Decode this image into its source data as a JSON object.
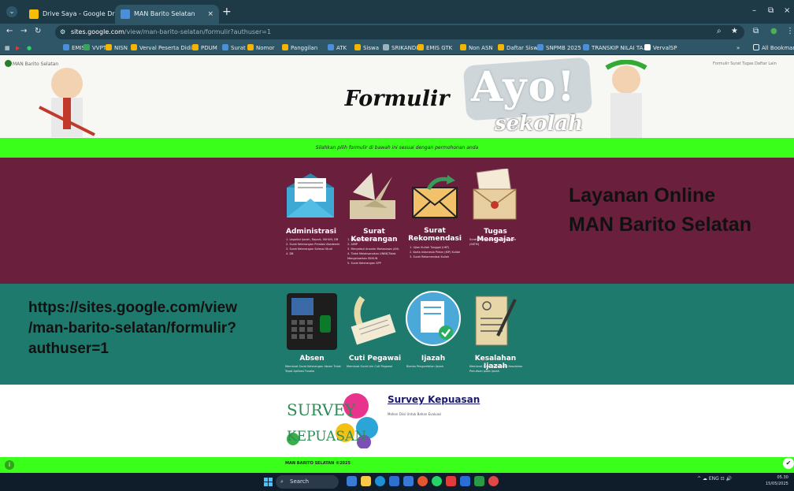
{
  "browser": {
    "tabs": [
      {
        "label": "Drive Saya - Google Drive",
        "close": "×",
        "favicon_color": "#fbbc04"
      },
      {
        "label": "MAN Barito Selatan",
        "close": "×",
        "favicon_color": "#4a8fd8"
      }
    ],
    "new_tab": "+",
    "window_controls": {
      "minimize": "–",
      "maximize": "⧉",
      "close": "×"
    },
    "address": {
      "host": "sites.google.com",
      "path": "/view/man-barito-selatan/formulir?authuser=1"
    },
    "bookmarks": [
      {
        "label": "EMIS",
        "color": "#4a8fd8"
      },
      {
        "label": "VVPTK",
        "color": "#3aa55a"
      },
      {
        "label": "NISN",
        "color": "#f4b400"
      },
      {
        "label": "Verval Peserta Didik",
        "color": "#f4b400"
      },
      {
        "label": "PDUM",
        "color": "#f4b400"
      },
      {
        "label": "Surat",
        "color": "#4a8fd8"
      },
      {
        "label": "Nomor",
        "color": "#f4b400"
      },
      {
        "label": "Panggilan",
        "color": "#f4b400"
      },
      {
        "label": "ATK",
        "color": "#4a8fd8"
      },
      {
        "label": "Siswa",
        "color": "#f4b400"
      },
      {
        "label": "SRIKANDI",
        "color": "#9ab3bd"
      },
      {
        "label": "EMIS GTK",
        "color": "#f4b400"
      },
      {
        "label": "Non ASN",
        "color": "#f4b400"
      },
      {
        "label": "Daftar Siswa",
        "color": "#f4b400"
      },
      {
        "label": "SNPMB 2025",
        "color": "#4a8fd8"
      },
      {
        "label": "TRANSKIP NILAI TA...",
        "color": "#4a8fd8"
      },
      {
        "label": "VervalSP",
        "color": "#ffffff"
      }
    ],
    "bookmarks_more": "»",
    "all_bookmarks": "All Bookmarks"
  },
  "site": {
    "brand": "MAN Barito Selatan",
    "top_nav": "Formulir   Surat Tugas   Daftar   Lain",
    "hero_word": "Ayo!",
    "hero_sub": "sekolah",
    "title": "Formulir",
    "instruction": "Silahkan pilih formulir di bawah ini sesuai dengan permohonan anda",
    "banner_line1": "Layanan Online",
    "banner_line2": "MAN Barito Selatan",
    "url_text": "https://sites.google.com/view/man-barito-selatan/formulir?authuser=1",
    "url_lines": [
      "https://sites.google.com/view",
      "/man-barito-selatan/formulir?",
      "authuser=1"
    ]
  },
  "services_row1": [
    {
      "title": "Administrasi",
      "items": [
        "1. Legalisir Ijazah, Raport, SKHUN, DB",
        "2. Surat Keterangan Prestasi Akademik",
        "3. Surat Keterangan Selesai Studi",
        "4. DB"
      ]
    },
    {
      "title": "Surat Keterangan",
      "items": [
        "1. Bebas Ieluan Buku",
        "2. AIMP",
        "3. Menyebut Anonim Mahasiswa (AH)",
        "4. Tidak Melaksanakan UNBK/Tidak Mengeluarkan SKHUN",
        "5. Surat Keterangan SPP"
      ]
    },
    {
      "title": "Surat Rekomendasi",
      "items": [
        "1. Ujian Kuliah Tunggal (UKT)",
        "2. Karta Indonesia Pintar (KIP) Kuliah",
        "3. Surat Rekomendasi Kuliah"
      ]
    },
    {
      "title": "Tugas Mengajar",
      "items": [
        "Surat Keterangan Tugas Mengajar (SKTM)"
      ]
    }
  ],
  "services_row2": [
    {
      "title": "Absen",
      "items": [
        "Membuat Surat Keterangan Absen Tidak Tepat Aplikasi Fusako"
      ]
    },
    {
      "title": "Cuti Pegawai",
      "items": [
        "Membuat Surat Izin Cuti Pegawai"
      ]
    },
    {
      "title": "Ijazah",
      "items": [
        "Blanko Pengambilan Ijazah"
      ]
    },
    {
      "title": "Kesalahan Ijazah",
      "items": [
        "Membuat Surat Keterangan Kesalahan Penulisan pada Ijazah"
      ]
    }
  ],
  "survey": {
    "image_text_top": "SURVEY",
    "image_text_bottom": "KEPUASAN",
    "link": "Survey Kepuasan",
    "subtitle": "Mohon Diisi Untuk Bahan Evaluasi"
  },
  "footer": {
    "text": "MAN BARITO SELATAN ©2025"
  },
  "taskbar": {
    "search": "Search",
    "tray": "^   ☁   ENG   ⊡  🔊",
    "time": "05.30",
    "date": "15/05/2025"
  },
  "colors": {
    "green": "#3aff1a",
    "maroon": "#6a1f3c",
    "teal": "#1f7a6e"
  }
}
